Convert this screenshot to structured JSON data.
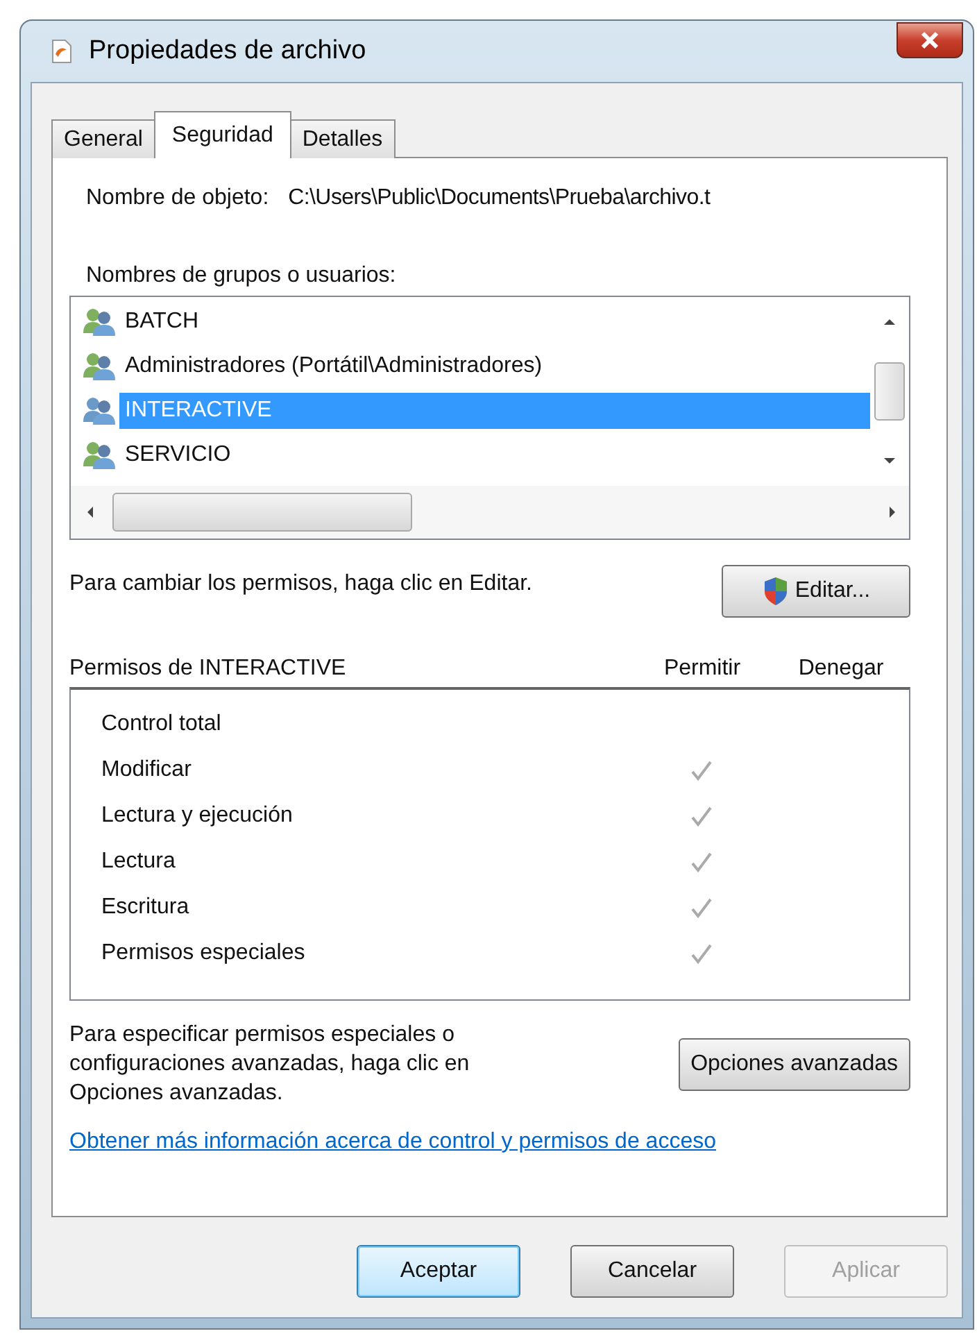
{
  "window": {
    "title": "Propiedades de archivo"
  },
  "tabs": [
    {
      "label": "General",
      "selected": false
    },
    {
      "label": "Seguridad",
      "selected": true
    },
    {
      "label": "Detalles",
      "selected": false
    }
  ],
  "object_name": {
    "label": "Nombre de objeto:",
    "value": "C:\\Users\\Public\\Documents\\Prueba\\archivo.t"
  },
  "groups": {
    "label": "Nombres de grupos o usuarios:",
    "items": [
      {
        "name": "BATCH",
        "selected": false
      },
      {
        "name": "Administradores (Portátil\\Administradores)",
        "selected": false
      },
      {
        "name": "INTERACTIVE",
        "selected": true
      },
      {
        "name": "SERVICIO",
        "selected": false
      }
    ]
  },
  "edit_hint": "Para cambiar los permisos, haga clic en Editar.",
  "edit_button": "Editar...",
  "permissions": {
    "title": "Permisos de INTERACTIVE",
    "allow_label": "Permitir",
    "deny_label": "Denegar",
    "rows": [
      {
        "name": "Control total",
        "allow": false,
        "deny": false
      },
      {
        "name": "Modificar",
        "allow": true,
        "deny": false
      },
      {
        "name": "Lectura y ejecución",
        "allow": true,
        "deny": false
      },
      {
        "name": "Lectura",
        "allow": true,
        "deny": false
      },
      {
        "name": "Escritura",
        "allow": true,
        "deny": false
      },
      {
        "name": "Permisos especiales",
        "allow": true,
        "deny": false
      }
    ]
  },
  "advanced_hint": "Para especificar permisos especiales o configuraciones avanzadas, haga clic en Opciones avanzadas.",
  "advanced_button": "Opciones avanzadas",
  "help_link": "Obtener más información acerca de control y permisos de acceso",
  "buttons": [
    {
      "label": "Aceptar",
      "default": true,
      "disabled": false
    },
    {
      "label": "Cancelar",
      "default": false,
      "disabled": false
    },
    {
      "label": "Aplicar",
      "default": false,
      "disabled": true
    }
  ]
}
